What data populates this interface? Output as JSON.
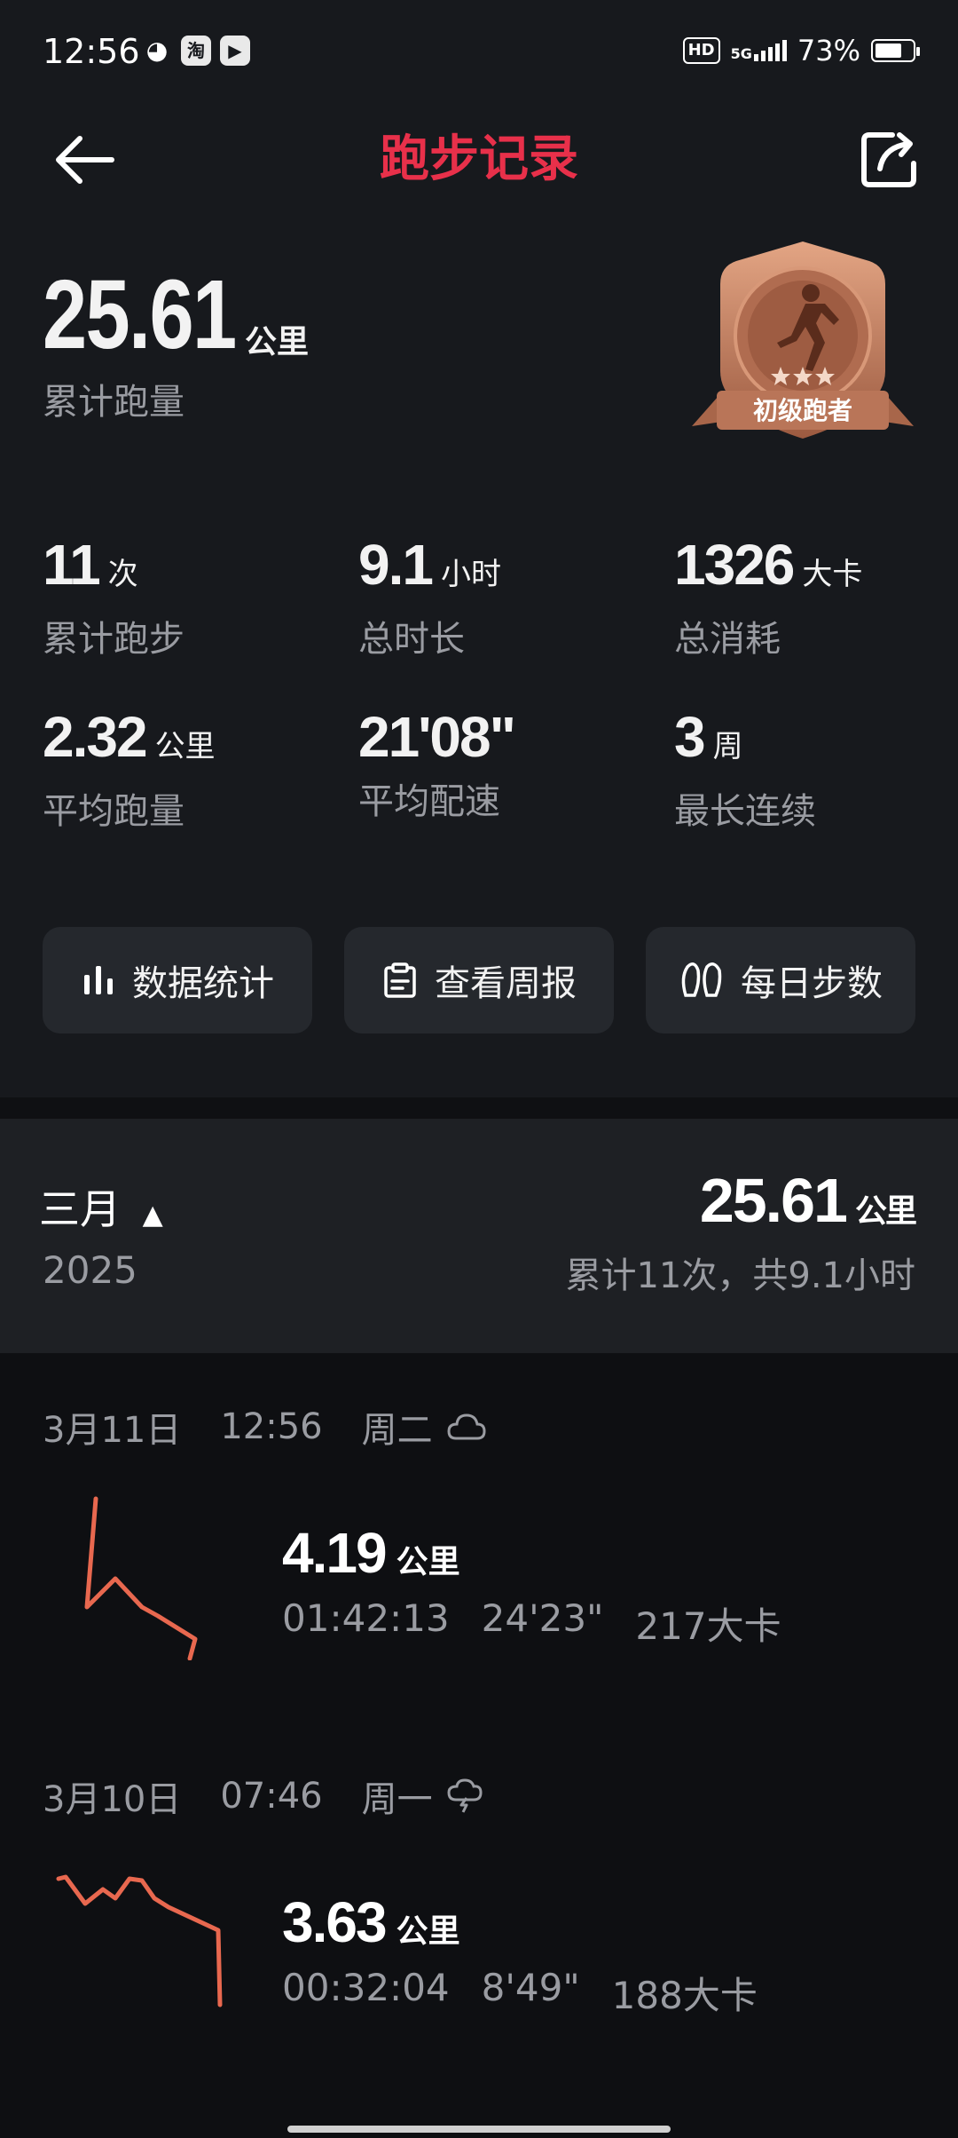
{
  "status_bar": {
    "time": "12:56",
    "left_icons": [
      "wechat-icon",
      "taobao-icon",
      "video-icon"
    ],
    "hd": "HD",
    "network": "5G",
    "battery": "73%",
    "battery_level": 0.73
  },
  "header": {
    "title": "跑步记录",
    "back_icon": "arrow-left-icon",
    "share_icon": "share-icon"
  },
  "summary": {
    "total_distance": "25.61",
    "total_unit": "公里",
    "total_label": "累计跑量",
    "badge_label": "初级跑者",
    "stats": [
      {
        "value": "11",
        "unit": "次",
        "label": "累计跑步"
      },
      {
        "value": "9.1",
        "unit": "小时",
        "label": "总时长"
      },
      {
        "value": "1326",
        "unit": "大卡",
        "label": "总消耗"
      },
      {
        "value": "2.32",
        "unit": "公里",
        "label": "平均跑量"
      },
      {
        "value": "21'08\"",
        "unit": "",
        "label": "平均配速"
      },
      {
        "value": "3",
        "unit": "周",
        "label": "最长连续"
      }
    ]
  },
  "actions": [
    {
      "label": "数据统计",
      "icon": "bar-chart-icon"
    },
    {
      "label": "查看周报",
      "icon": "clipboard-icon"
    },
    {
      "label": "每日步数",
      "icon": "footprints-icon"
    }
  ],
  "month": {
    "name": "三月",
    "year": "2025",
    "total": "25.61",
    "unit": "公里",
    "summary": "累计11次，共9.1小时"
  },
  "records": [
    {
      "date": "3月11日",
      "time": "12:56",
      "weekday": "周二",
      "weather_icon": "cloudy-icon",
      "distance": "4.19",
      "unit": "公里",
      "duration": "01:42:13",
      "pace": "24'23\"",
      "calories": "217大卡"
    },
    {
      "date": "3月10日",
      "time": "07:46",
      "weekday": "周一",
      "weather_icon": "thunderstorm-icon",
      "distance": "3.63",
      "unit": "公里",
      "duration": "00:32:04",
      "pace": "8'49\"",
      "calories": "188大卡"
    }
  ],
  "colors": {
    "accent": "#e8304a",
    "route": "#e8684f",
    "badge": "#c07a5c"
  }
}
